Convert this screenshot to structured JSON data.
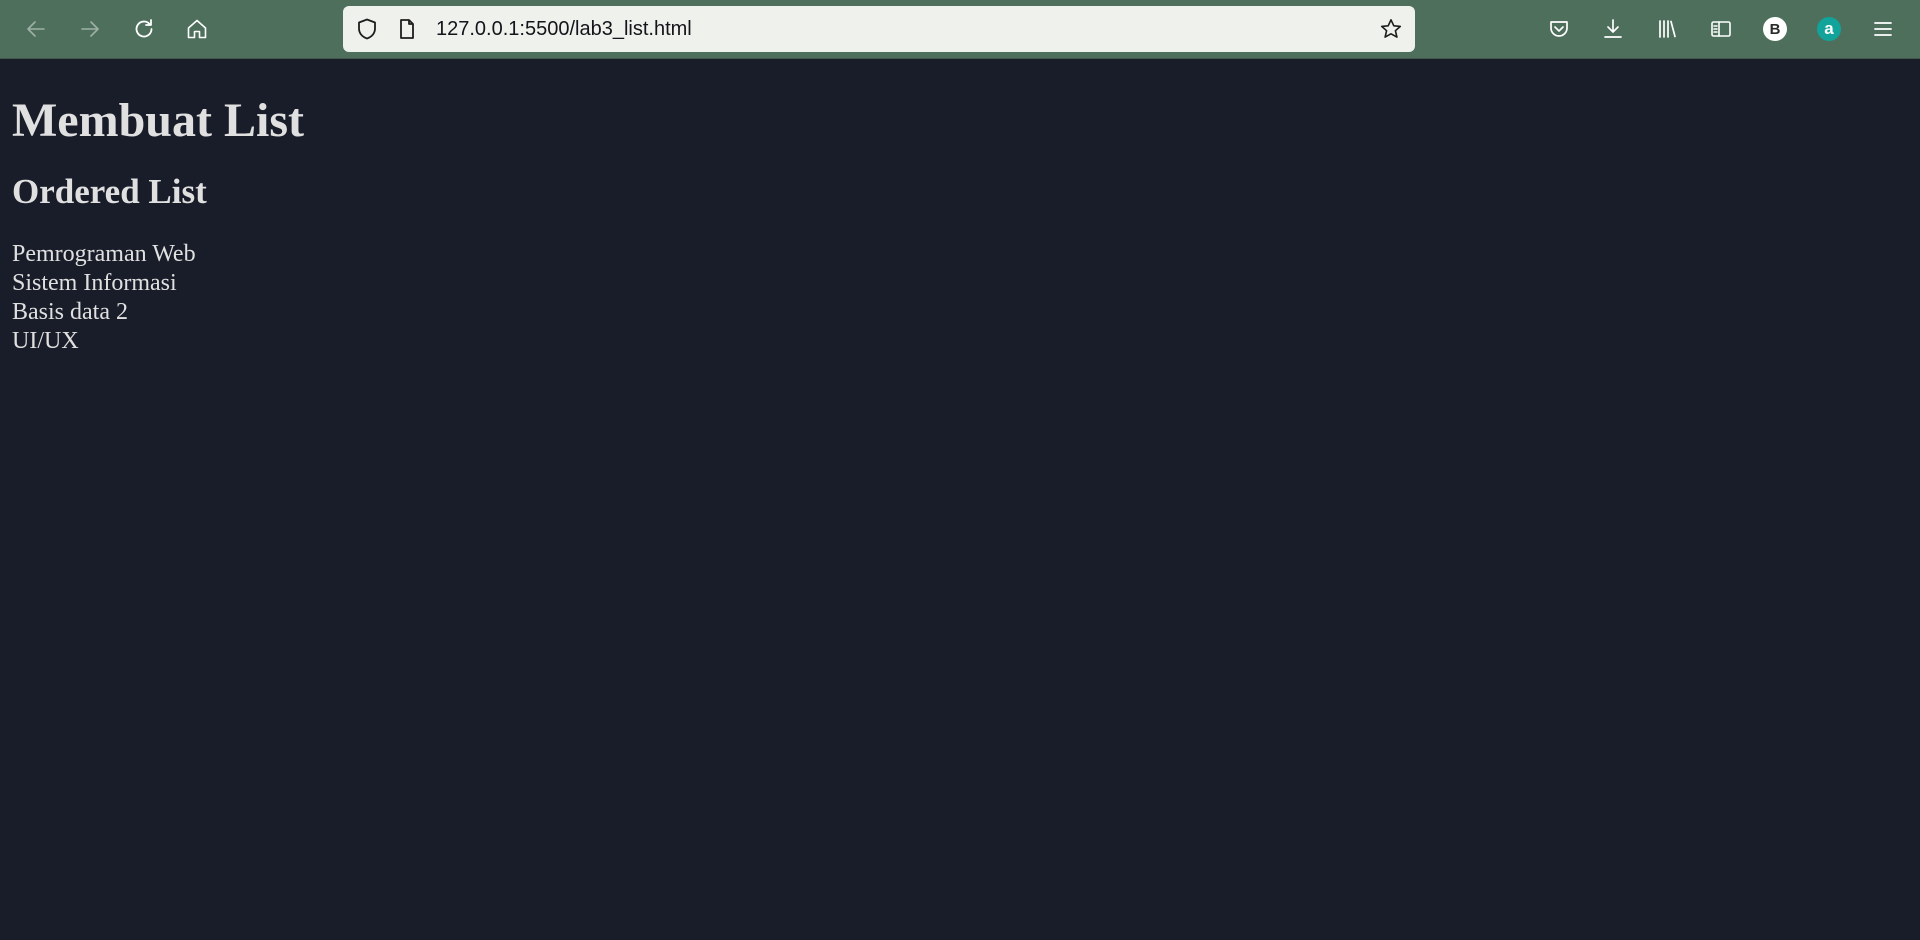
{
  "browser": {
    "url": "127.0.0.1:5500/lab3_list.html",
    "toolbar_color": "#4e6f5c",
    "icons": {
      "back": "back-arrow-icon",
      "forward": "forward-arrow-icon",
      "reload": "reload-icon",
      "home": "home-icon",
      "tracking_protection": "shield-icon",
      "page_info": "page-icon",
      "bookmark": "star-icon",
      "pocket": "pocket-icon",
      "downloads": "download-icon",
      "library": "library-icon",
      "sidebar": "sidebar-icon",
      "menu": "hamburger-menu-icon"
    },
    "extensions": [
      {
        "name": "profile-avatar",
        "letter": "B",
        "bg": "#ffffff",
        "fg": "#2b2b2b"
      },
      {
        "name": "extension-a",
        "letter": "a",
        "bg": "#12a39a",
        "fg": "#ffffff"
      }
    ]
  },
  "page": {
    "background": "#191d29",
    "text_color": "#e0e0e0",
    "title": "Membuat List",
    "subtitle": "Ordered List",
    "items": [
      "Pemrograman Web",
      "Sistem Informasi",
      "Basis data 2",
      "UI/UX"
    ]
  }
}
